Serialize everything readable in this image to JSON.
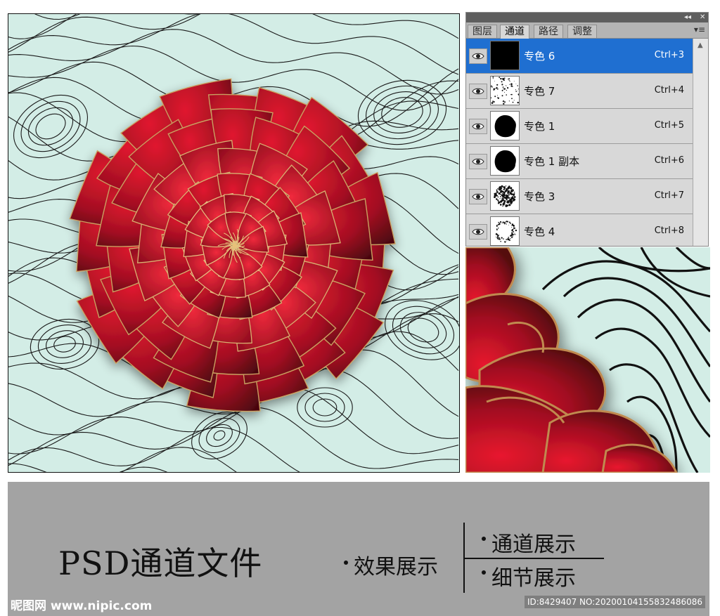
{
  "panel": {
    "tabs": [
      "图层",
      "通道",
      "路径",
      "调整"
    ],
    "active_tab": "通道",
    "channels": [
      {
        "name": "专色 6",
        "shortcut": "Ctrl+3",
        "selected": true,
        "thumb": "black"
      },
      {
        "name": "专色 7",
        "shortcut": "Ctrl+4",
        "selected": false,
        "thumb": "speckle"
      },
      {
        "name": "专色 1",
        "shortcut": "Ctrl+5",
        "selected": false,
        "thumb": "blob"
      },
      {
        "name": "专色 1 副本",
        "shortcut": "Ctrl+6",
        "selected": false,
        "thumb": "blob"
      },
      {
        "name": "专色 3",
        "shortcut": "Ctrl+7",
        "selected": false,
        "thumb": "texture"
      },
      {
        "name": "专色 4",
        "shortcut": "Ctrl+8",
        "selected": false,
        "thumb": "ring"
      }
    ],
    "icons": {
      "visibility": "eye-icon",
      "collapse": "double-arrow-icon",
      "close": "close-icon",
      "menu": "panel-menu-icon"
    }
  },
  "band": {
    "title": "PSD通道文件",
    "effect": "效果展示",
    "channels_show": "通道展示",
    "detail_show": "细节展示",
    "watermark": "昵图网 www.nipic.com",
    "id_text": "ID:8429407 NO:20200104155832486086"
  },
  "colors": {
    "background": "#d3ede6",
    "selection": "#1f6fd1",
    "petal_dark": "#5a0812",
    "petal_bright": "#d8142e",
    "gold_outline": "#c9a060",
    "band": "#a3a3a3"
  }
}
